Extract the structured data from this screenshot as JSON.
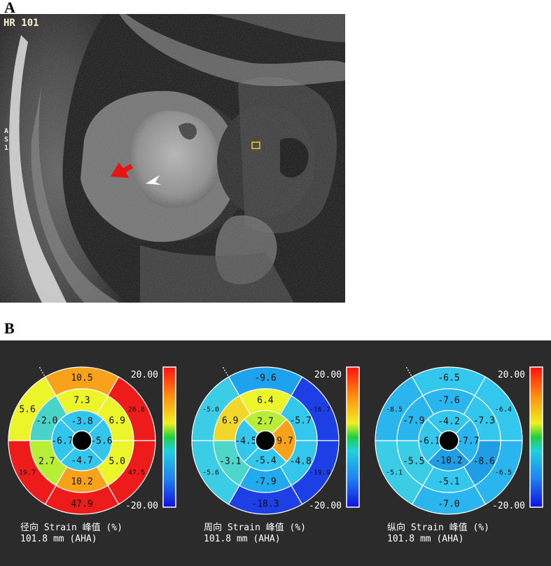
{
  "panel_a": {
    "letter": "A",
    "hr_label": "HR 101",
    "side_label_lines": [
      "A",
      "S",
      "1"
    ]
  },
  "panel_b": {
    "letter": "B",
    "plots": [
      {
        "id": "radial",
        "caption_line1": "径向 Strain 峰值 (%)",
        "caption_line2": "101.8 mm (AHA)",
        "scale_max": "20.00",
        "scale_min": "-20.00",
        "segments": {
          "basal": [
            "10.5",
            "26.8",
            "47.5",
            "47.9",
            "19.7",
            "5.6"
          ],
          "mid": [
            "7.3",
            "6.9",
            "5.0",
            "10.2",
            "2.7",
            "-2.0"
          ],
          "apical": [
            "-3.8",
            "-5.6",
            "-4.7",
            "-6.7"
          ]
        },
        "colors": {
          "basal": [
            "#f7a21a",
            "#ee1b1b",
            "#ee1b1b",
            "#ee1b1b",
            "#ee1b1b",
            "#ecf42a"
          ],
          "mid": [
            "#ecf42a",
            "#ecf42a",
            "#ecf42a",
            "#f7a21a",
            "#b9ee36",
            "#4ad4c9"
          ],
          "apical": [
            "#32c5ee",
            "#32c5ee",
            "#32c5ee",
            "#32c5ee"
          ]
        }
      },
      {
        "id": "circumferential",
        "caption_line1": "周向 Strain 峰值 (%)",
        "caption_line2": "101.8 mm (AHA)",
        "scale_max": "20.00",
        "scale_min": "-20.00",
        "segments": {
          "basal": [
            "-9.6",
            "-16.7",
            "-19.9",
            "-18.3",
            "-5.6",
            "-5.0"
          ],
          "mid": [
            "6.4",
            "-5.7",
            "-4.8",
            "-7.9",
            "-3.1",
            "6.9"
          ],
          "apical": [
            "2.7",
            "9.7",
            "-5.4",
            "-4.5"
          ]
        },
        "colors": {
          "basal": [
            "#1fa2ee",
            "#1c3fe6",
            "#1c3fe6",
            "#1c3fe6",
            "#3bcde6",
            "#3bcde6"
          ],
          "mid": [
            "#ecf42a",
            "#33c7ee",
            "#33c7ee",
            "#22aaee",
            "#4dd6c9",
            "#f2d72a"
          ],
          "apical": [
            "#b9ee36",
            "#f7a21a",
            "#33c7ee",
            "#33c7ee"
          ]
        }
      },
      {
        "id": "longitudinal",
        "caption_line1": "纵向 Strain 峰值 (%)",
        "caption_line2": "101.8 mm (AHA)",
        "scale_max": "20.00",
        "scale_min": "-20.00",
        "segments": {
          "basal": [
            "-6.5",
            "-6.4",
            "-6.5",
            "-7.0",
            "-5.1",
            "-8.5"
          ],
          "mid": [
            "-7.6",
            "-7.3",
            "-8.6",
            "-5.1",
            "-5.5",
            "-7.9"
          ],
          "apical": [
            "-4.2",
            "-7.7",
            "-10.2",
            "-6.1"
          ]
        },
        "colors": {
          "basal": [
            "#33c7ee",
            "#33c7ee",
            "#2ab5ee",
            "#2ab5ee",
            "#3bcde6",
            "#2ab5ee"
          ],
          "mid": [
            "#2ab5ee",
            "#33c7ee",
            "#1f9ee6",
            "#33c7ee",
            "#3bcde6",
            "#2ab5ee"
          ],
          "apical": [
            "#33c7ee",
            "#2ab5ee",
            "#1f9ee6",
            "#33c7ee"
          ]
        }
      }
    ]
  }
}
